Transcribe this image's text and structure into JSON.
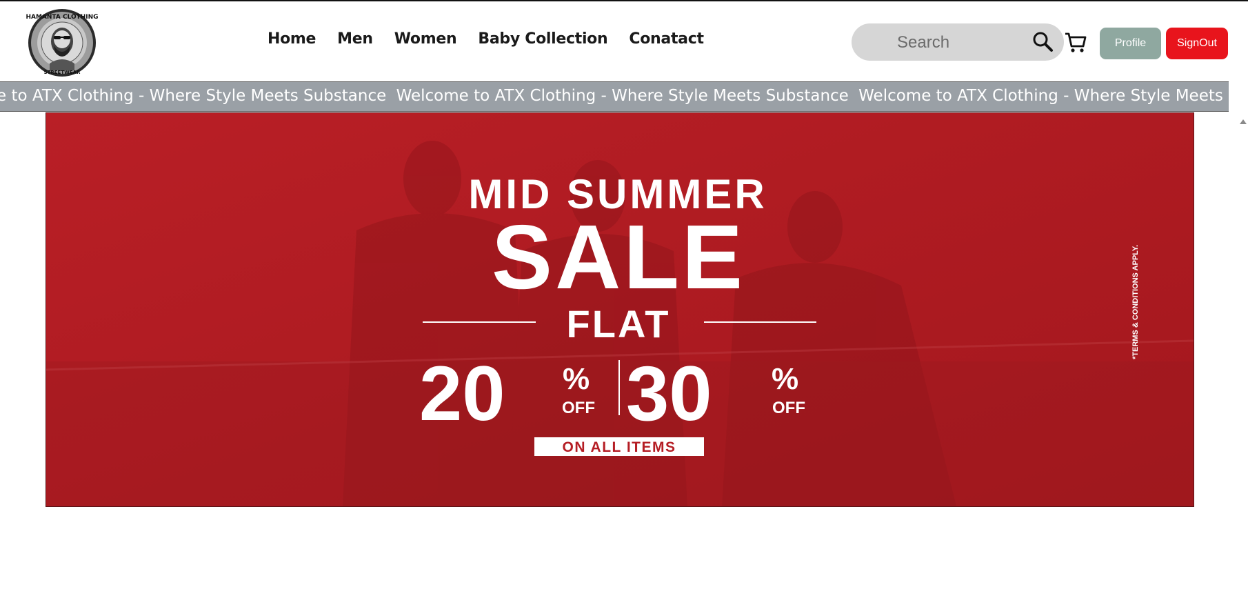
{
  "header": {
    "logo_alt": "Hamanta Clothing Streetwear",
    "logo_text_top": "HAMANTA CLOTHING",
    "logo_text_bottom": "STREETWEAR"
  },
  "nav": {
    "items": [
      {
        "label": "Home"
      },
      {
        "label": "Men"
      },
      {
        "label": "Women"
      },
      {
        "label": "Baby Collection"
      },
      {
        "label": "Conatact"
      }
    ]
  },
  "search": {
    "placeholder": "Search",
    "icon": "search-icon"
  },
  "cart": {
    "icon": "cart-icon"
  },
  "buttons": {
    "profile_label": "Profile",
    "signout_label": "SignOut"
  },
  "marquee": {
    "text": "Welcome to ATX Clothing - Where Style Meets Substance"
  },
  "banner": {
    "line1": "MID SUMMER",
    "line2": "SALE",
    "line3": "FLAT",
    "discount1": "20",
    "discount2": "30",
    "percent_sign": "%",
    "off_label": "OFF",
    "cta": "ON ALL ITEMS",
    "terms": "*TERMS & CONDITIONS APPLY."
  },
  "colors": {
    "banner_red": "#b51d24",
    "signout_red": "#e8141c",
    "profile_green": "#8fa8a0",
    "marquee_gray": "#9aa0a6"
  }
}
